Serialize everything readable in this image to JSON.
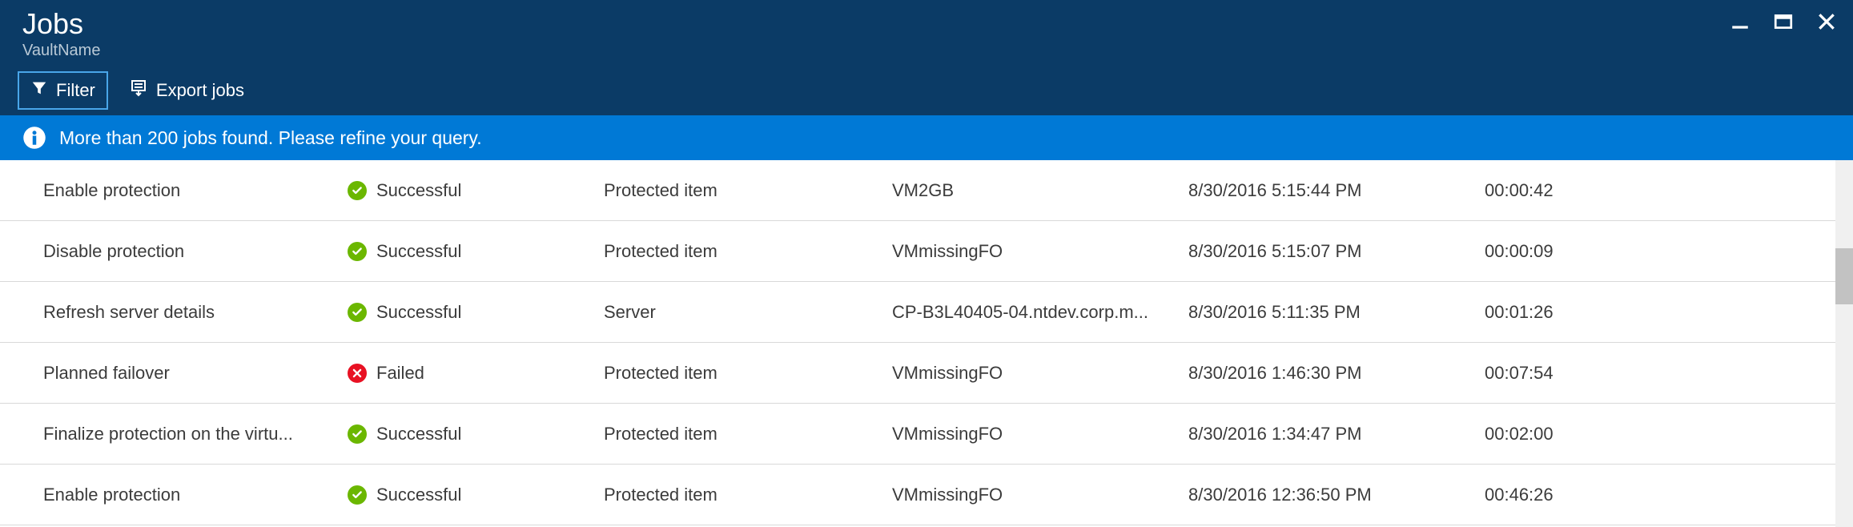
{
  "header": {
    "title": "Jobs",
    "subtitle": "VaultName"
  },
  "toolbar": {
    "filter_label": "Filter",
    "export_label": "Export jobs"
  },
  "info_message": "More than 200 jobs found. Please refine your query.",
  "statuses": {
    "success": "Successful",
    "failed": "Failed"
  },
  "rows": [
    {
      "operation": "Enable protection",
      "status": "success",
      "type": "Protected item",
      "item": "VM2GB",
      "start": "8/30/2016 5:15:44 PM",
      "duration": "00:00:42"
    },
    {
      "operation": "Disable protection",
      "status": "success",
      "type": "Protected item",
      "item": "VMmissingFO",
      "start": "8/30/2016 5:15:07 PM",
      "duration": "00:00:09"
    },
    {
      "operation": "Refresh server details",
      "status": "success",
      "type": "Server",
      "item": "CP-B3L40405-04.ntdev.corp.m...",
      "start": "8/30/2016 5:11:35 PM",
      "duration": "00:01:26"
    },
    {
      "operation": "Planned failover",
      "status": "failed",
      "type": "Protected item",
      "item": "VMmissingFO",
      "start": "8/30/2016 1:46:30 PM",
      "duration": "00:07:54"
    },
    {
      "operation": "Finalize protection on the virtu...",
      "status": "success",
      "type": "Protected item",
      "item": "VMmissingFO",
      "start": "8/30/2016 1:34:47 PM",
      "duration": "00:02:00"
    },
    {
      "operation": "Enable protection",
      "status": "success",
      "type": "Protected item",
      "item": "VMmissingFO",
      "start": "8/30/2016 12:36:50 PM",
      "duration": "00:46:26"
    }
  ]
}
